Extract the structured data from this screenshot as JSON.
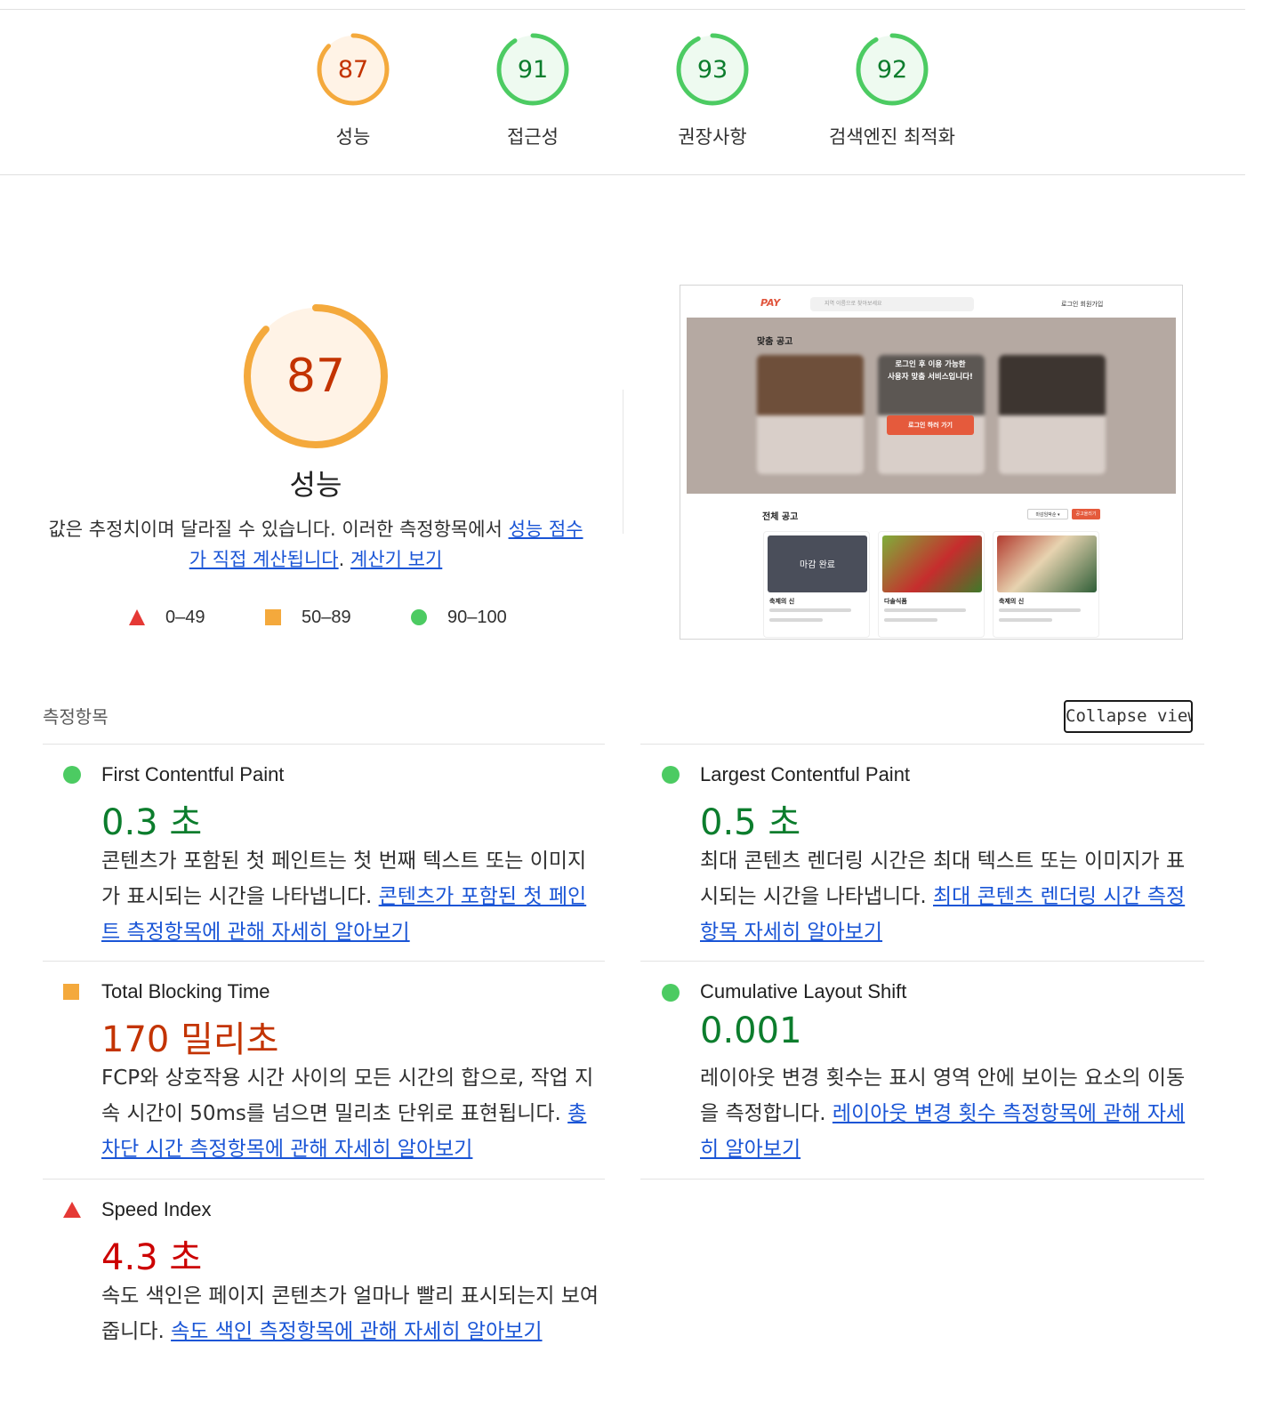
{
  "scores": [
    {
      "value": "87",
      "label": "성능",
      "fraction": 0.87,
      "rating": "average"
    },
    {
      "value": "91",
      "label": "접근성",
      "fraction": 0.91,
      "rating": "pass"
    },
    {
      "value": "93",
      "label": "권장사항",
      "fraction": 0.93,
      "rating": "pass"
    },
    {
      "value": "92",
      "label": "검색엔진 최적화",
      "fraction": 0.92,
      "rating": "pass"
    }
  ],
  "performance": {
    "score": "87",
    "fraction": 0.87,
    "title": "성능",
    "description_prefix": "값은 추정치이며 달라질 수 있습니다. 이러한 측정항목에서 ",
    "description_link": "성능 점수가 직접 계산됩니다",
    "description_mid": ". ",
    "calculator_link": "계산기 보기"
  },
  "legend": [
    {
      "range": "0–49",
      "shape": "triangle",
      "color": "#e53935"
    },
    {
      "range": "50–89",
      "shape": "square",
      "color": "#f4a93c"
    },
    {
      "range": "90–100",
      "shape": "circle",
      "color": "#4ccb62"
    }
  ],
  "screenshot": {
    "logo": "PAY",
    "search_placeholder": "지역 이름으로 찾아보세요",
    "nav": "로그인  회원가입",
    "hero_title": "맞춤 공고",
    "notice_line1": "로그인 후 이용 가능한",
    "notice_line2": "사용자 맞춤 서비스입니다!",
    "notice_button": "로그인 하러 가기",
    "all_title": "전체 공고",
    "sort_label": "마감임박순 ▾",
    "write_label": "공고올리기",
    "cards": [
      {
        "name": "축제의 신",
        "overlay": "마감 완료"
      },
      {
        "name": "다솔식품",
        "overlay": ""
      },
      {
        "name": "축제의 신",
        "overlay": ""
      }
    ]
  },
  "metrics_header": "측정항목",
  "collapse_label": "Collapse view",
  "metrics": [
    {
      "name": "First Contentful Paint",
      "value": "0.3 초",
      "rating": "pass",
      "desc": "콘텐츠가 포함된 첫 페인트는 첫 번째 텍스트 또는 이미지가 표시되는 시간을 나타냅니다. ",
      "link": "콘텐츠가 포함된 첫 페인트 측정항목에 관해 자세히 알아보기"
    },
    {
      "name": "Largest Contentful Paint",
      "value": "0.5 초",
      "rating": "pass",
      "desc": "최대 콘텐츠 렌더링 시간은 최대 텍스트 또는 이미지가 표시되는 시간을 나타냅니다. ",
      "link": "최대 콘텐츠 렌더링 시간 측정항목 자세히 알아보기"
    },
    {
      "name": "Total Blocking Time",
      "value": "170 밀리초",
      "rating": "average",
      "desc": "FCP와 상호작용 시간 사이의 모든 시간의 합으로, 작업 지속 시간이 50ms를 넘으면 밀리초 단위로 표현됩니다. ",
      "link": "총 차단 시간 측정항목에 관해 자세히 알아보기"
    },
    {
      "name": "Cumulative Layout Shift",
      "value": "0.001",
      "rating": "pass",
      "desc": "레이아웃 변경 횟수는 표시 영역 안에 보이는 요소의 이동을 측정합니다. ",
      "link": "레이아웃 변경 횟수 측정항목에 관해 자세히 알아보기"
    },
    {
      "name": "Speed Index",
      "value": "4.3 초",
      "rating": "fail",
      "desc": "속도 색인은 페이지 콘텐츠가 얼마나 빨리 표시되는지 보여줍니다. ",
      "link": "속도 색인 측정항목에 관해 자세히 알아보기"
    }
  ],
  "colors": {
    "pass": "#0c7d2d",
    "average": "#c33300",
    "fail": "#cc0000",
    "pass_ring": "#4ccb62",
    "average_ring": "#f4a93c",
    "fail_icon": "#e53935",
    "link": "#1a55d6"
  }
}
